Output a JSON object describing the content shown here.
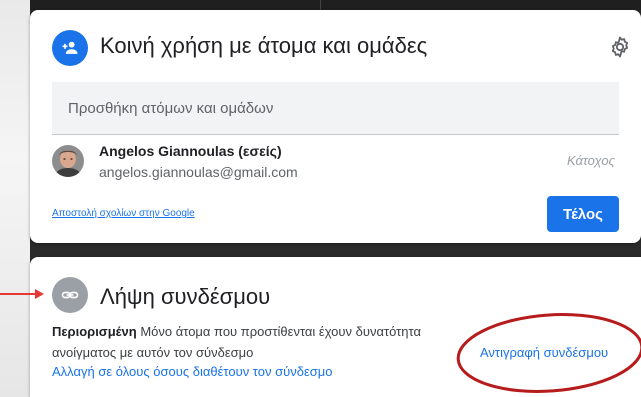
{
  "share_dialog": {
    "title": "Κοινή χρήση με άτομα και ομάδες",
    "search_placeholder": "Προσθήκη ατόμων και ομάδων",
    "user": {
      "name": "Angelos Giannoulas (εσείς)",
      "email": "angelos.giannoulas@gmail.com",
      "role": "Κάτοχος"
    },
    "feedback_link": "Αποστολή σχολίων στην Google",
    "done_label": "Τέλος",
    "icons": {
      "header": "person-add-icon",
      "settings": "gear-icon"
    },
    "colors": {
      "accent": "#1a73e8"
    }
  },
  "link_dialog": {
    "title": "Λήψη συνδέσμου",
    "restriction_bold": "Περιορισμένη",
    "restriction_text_1": "Μόνο άτομα που προστίθενται έχουν δυνατότητα",
    "restriction_text_2": "ανοίγματος με αυτόν τον σύνδεσμο",
    "change_link": "Αλλαγή σε όλους όσους διαθέτουν τον σύνδεσμο",
    "copy_link": "Αντιγραφή συνδέσμου",
    "icons": {
      "header": "link-icon"
    }
  },
  "annotations": {
    "color": "#b71c1c",
    "arrow_color": "#e53935"
  }
}
